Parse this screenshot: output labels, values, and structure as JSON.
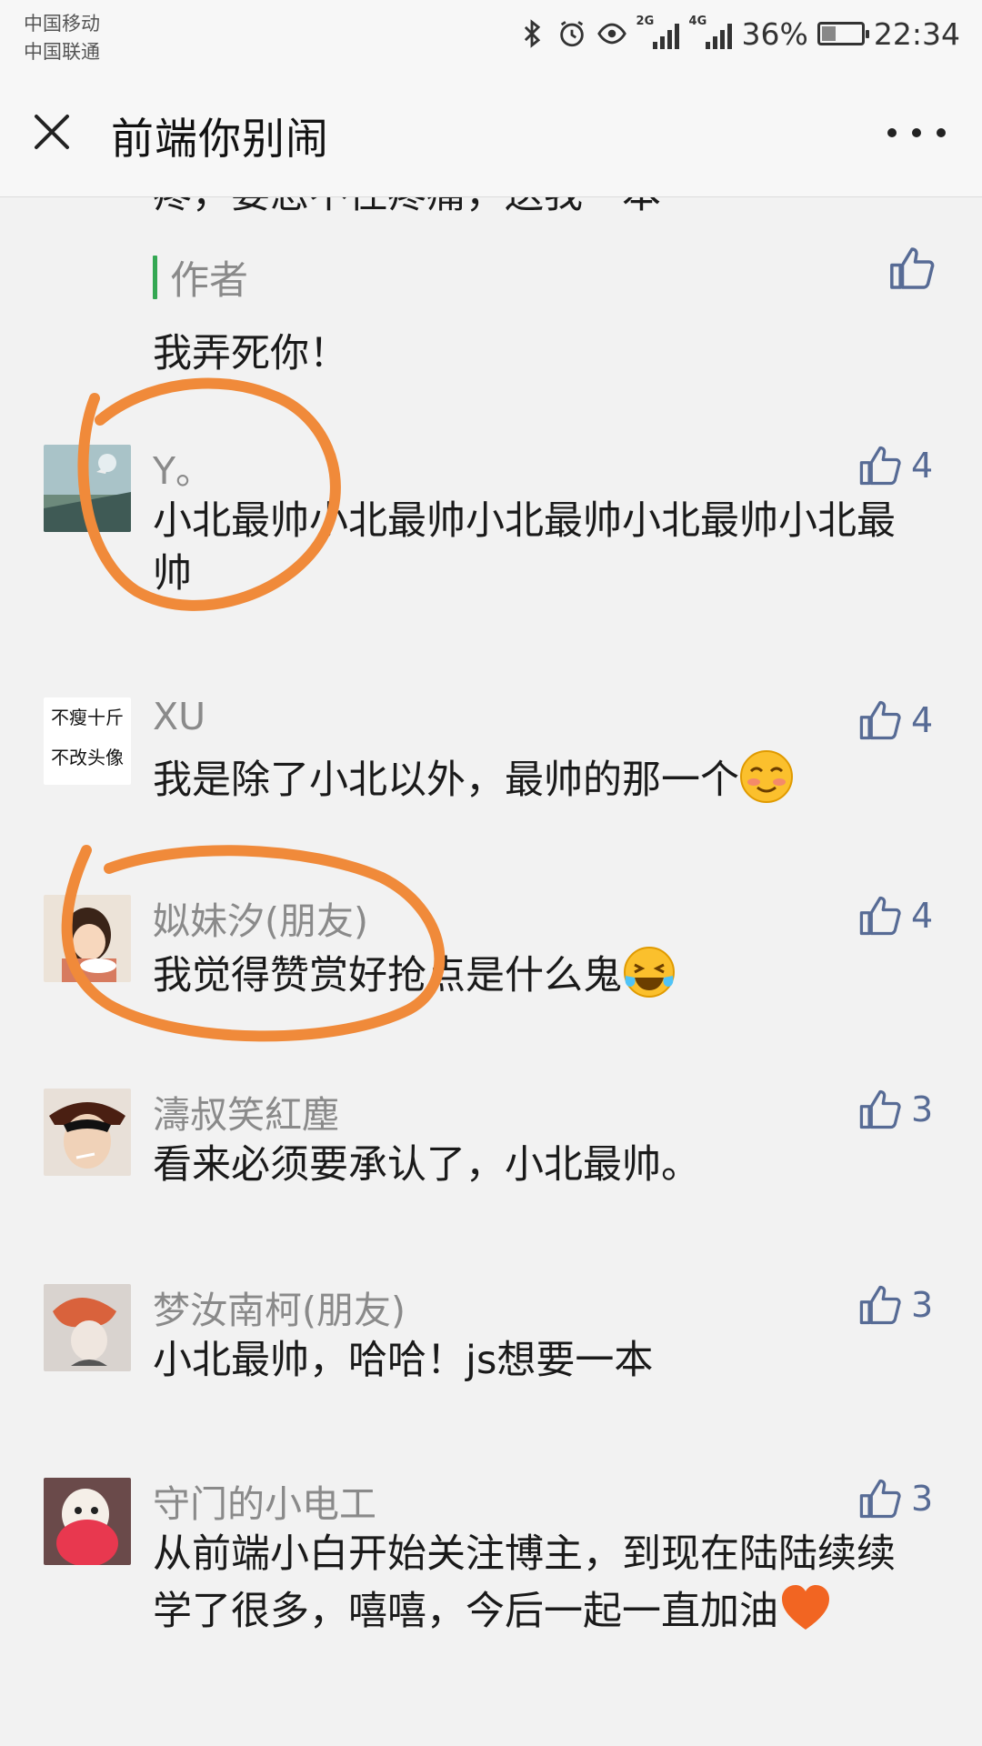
{
  "status_bar": {
    "carrier1": "中国移动",
    "carrier2": "中国联通",
    "sig1_label": "2G",
    "sig2_label": "4G",
    "battery_percent": "36%",
    "battery_level": 0.36,
    "time": "22:34",
    "icons": [
      "bluetooth-icon",
      "alarm-icon",
      "eye-icon",
      "signal-icon",
      "battery-icon"
    ]
  },
  "nav": {
    "title": "前端你别闹",
    "icons": [
      "close-icon",
      "more-icon"
    ]
  },
  "top_partial": {
    "cut_text": "疼，要忍不住疼痛，送我一本",
    "author_label": "作者",
    "author_reply": "我弄死你！"
  },
  "comments": [
    {
      "name": "Y。",
      "text": "小北最帅小北最帅小北最帅小北最帅小北最帅",
      "likes": "4",
      "emoji": ""
    },
    {
      "name": "XU",
      "text": "我是除了小北以外，最帅的那一个",
      "likes": "4",
      "emoji": "shy-smile-emoji",
      "avatar_line1": "不瘦十斤",
      "avatar_line2": "不改头像"
    },
    {
      "name": "姒妹汐(朋友)",
      "text": "我觉得赞赏好抢点是什么鬼",
      "likes": "4",
      "emoji": "tears-of-joy-emoji"
    },
    {
      "name": "濤叔笑紅塵",
      "text": "看来必须要承认了，小北最帅。",
      "likes": "3",
      "emoji": ""
    },
    {
      "name": "梦汝南柯(朋友)",
      "text": "小北最帅，哈哈！js想要一本",
      "likes": "3",
      "emoji": ""
    },
    {
      "name": "守门的小电工",
      "text": "从前端小白开始关注博主，到现在陆陆续续学了很多，嘻嘻，今后一起一直加油",
      "likes": "3",
      "emoji": "orange-heart-emoji"
    }
  ],
  "colors": {
    "background": "#f2f2f2",
    "link_blue": "#576b95",
    "author_green": "#34a853",
    "annotation_orange": "#f08a3a"
  }
}
